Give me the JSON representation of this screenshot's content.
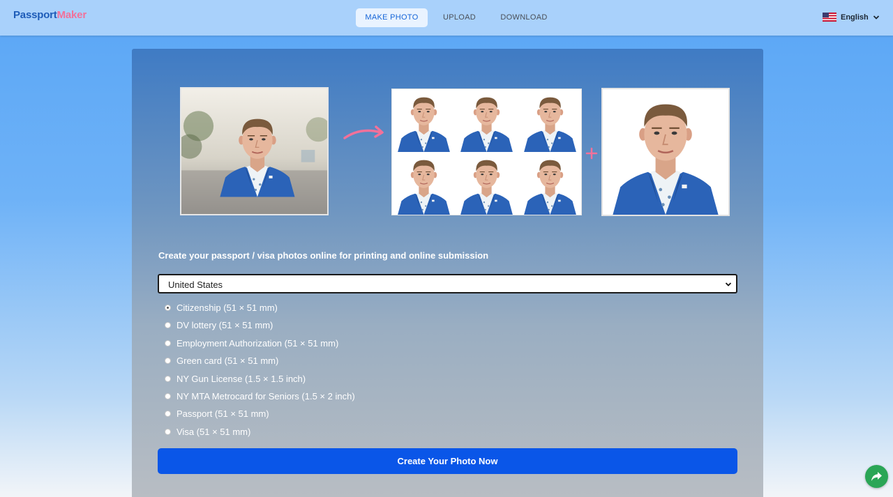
{
  "brand": {
    "part1": "Passport",
    "part2": "Maker"
  },
  "nav": {
    "items": [
      {
        "label": "MAKE PHOTO",
        "active": true
      },
      {
        "label": "UPLOAD",
        "active": false
      },
      {
        "label": "DOWNLOAD",
        "active": false
      }
    ]
  },
  "language": {
    "label": "English",
    "flag": "us-flag-icon"
  },
  "hero": {
    "arrow_color": "#f2719a",
    "plus_color": "#f2719a"
  },
  "form": {
    "headline": "Create your passport / visa photos online for printing and online submission",
    "country": "United States",
    "document_types": [
      {
        "label": "Citizenship (51 × 51 mm)",
        "checked": true
      },
      {
        "label": "DV lottery (51 × 51 mm)",
        "checked": false
      },
      {
        "label": "Employment Authorization (51 × 51 mm)",
        "checked": false
      },
      {
        "label": "Green card (51 × 51 mm)",
        "checked": false
      },
      {
        "label": "NY Gun License (1.5 × 1.5 inch)",
        "checked": false
      },
      {
        "label": "NY MTA Metrocard for Seniors (1.5 × 2 inch)",
        "checked": false
      },
      {
        "label": "Passport (51 × 51 mm)",
        "checked": false
      },
      {
        "label": "Visa (51 × 51 mm)",
        "checked": false
      }
    ],
    "submit_label": "Create Your Photo Now"
  },
  "colors": {
    "accent": "#0a56e8",
    "brand_blue": "#1e5cb8",
    "brand_pink": "#f2719a",
    "share_green": "#2aa656"
  }
}
